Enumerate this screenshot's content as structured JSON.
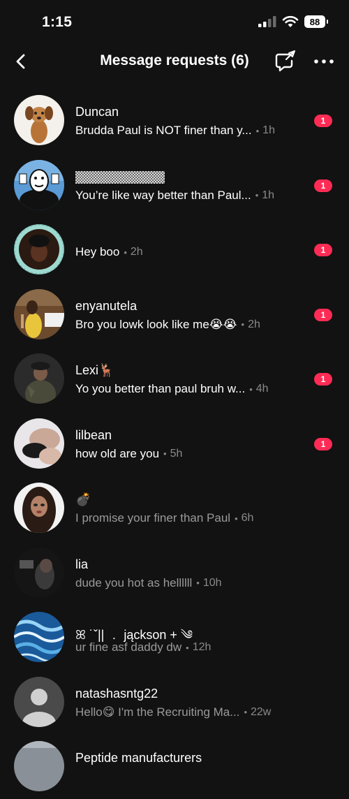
{
  "status_bar": {
    "time": "1:15",
    "battery": "88"
  },
  "header": {
    "title": "Message requests (6)",
    "back_icon": "chevron-left-icon",
    "filter_icon": "message-filter-icon",
    "more_icon": "more-dots-icon"
  },
  "requests": [
    {
      "name": "Duncan",
      "message": "Brudda Paul is NOT finer than y...",
      "time": "1h",
      "unread": "1"
    },
    {
      "name": "",
      "message": "You’re like way better than Paul...",
      "time": "1h",
      "unread": "1"
    },
    {
      "name": "",
      "message": "Hey boo",
      "time": "2h",
      "unread": "1"
    },
    {
      "name": "enyanutela",
      "message": "Bro you lowk look like me😭😭",
      "time": "2h",
      "unread": "1"
    },
    {
      "name": "Lexi🦌",
      "message": "Yo you better than paul bruh w...",
      "time": "4h",
      "unread": "1"
    },
    {
      "name": "lilbean",
      "message": "how old are you",
      "time": "5h",
      "unread": "1"
    },
    {
      "name": "💣",
      "message": "I promise your finer than Paul",
      "time": "6h",
      "unread": ""
    },
    {
      "name": "lia",
      "message": "dude you hot as hellllll",
      "time": "10h",
      "unread": ""
    },
    {
      "name": "ꕤ ˙ˇ||  ﹒ jąckson  +  ༄",
      "message": "ur fine asf daddy dw",
      "time": "12h",
      "unread": ""
    },
    {
      "name": "natashasntg22",
      "message": "Hello😋 I'm the Recruiting Ma...",
      "time": "22w",
      "unread": ""
    },
    {
      "name": "Peptide manufacturers",
      "message": "",
      "time": "",
      "unread": ""
    }
  ],
  "colors": {
    "background": "#121212",
    "badge": "#fe2c55",
    "secondary_text": "#8a8a8a"
  }
}
